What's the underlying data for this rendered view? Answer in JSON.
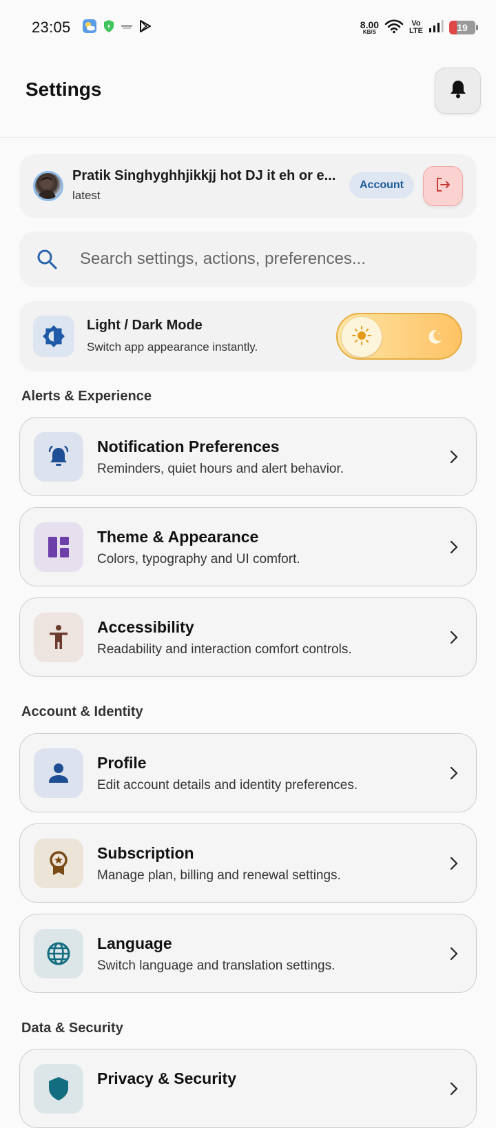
{
  "status_bar": {
    "time": "23:05",
    "net_speed_value": "8.00",
    "net_speed_unit": "KB/S",
    "volte_top": "Vo",
    "volte_bottom": "LTE",
    "battery": "19"
  },
  "header": {
    "title": "Settings"
  },
  "account": {
    "name": "Pratik Singhyghhjikkjj hot DJ it eh or e...",
    "subtitle": "latest",
    "pill_label": "Account"
  },
  "search": {
    "placeholder": "Search settings, actions, preferences..."
  },
  "mode": {
    "title": "Light / Dark Mode",
    "subtitle": "Switch app appearance instantly.",
    "state": "light"
  },
  "sections": [
    {
      "title": "Alerts & Experience",
      "items": [
        {
          "title": "Notification Preferences",
          "subtitle": "Reminders, quiet hours and alert behavior.",
          "icon": "bell-ring-icon",
          "icon_color": "#1e4e93",
          "icon_bg": "#dce3ef"
        },
        {
          "title": "Theme & Appearance",
          "subtitle": "Colors, typography and UI comfort.",
          "icon": "dashboard-layout-icon",
          "icon_color": "#6d3fa8",
          "icon_bg": "#e6e0ee"
        },
        {
          "title": "Accessibility",
          "subtitle": "Readability and interaction comfort controls.",
          "icon": "accessibility-icon",
          "icon_color": "#6a3a2c",
          "icon_bg": "#ede3df"
        }
      ]
    },
    {
      "title": "Account & Identity",
      "items": [
        {
          "title": "Profile",
          "subtitle": "Edit account details and identity preferences.",
          "icon": "person-icon",
          "icon_color": "#1e4e93",
          "icon_bg": "#dce3ef"
        },
        {
          "title": "Subscription",
          "subtitle": "Manage plan, billing and renewal settings.",
          "icon": "award-badge-icon",
          "icon_color": "#7a4a16",
          "icon_bg": "#ede4d8"
        },
        {
          "title": "Language",
          "subtitle": "Switch language and translation settings.",
          "icon": "globe-icon",
          "icon_color": "#136d80",
          "icon_bg": "#dce6e9"
        }
      ]
    },
    {
      "title": "Data & Security",
      "items": [
        {
          "title": "Privacy & Security",
          "subtitle": "",
          "icon": "shield-icon",
          "icon_color": "#136d80",
          "icon_bg": "#dce6e9"
        }
      ]
    }
  ]
}
